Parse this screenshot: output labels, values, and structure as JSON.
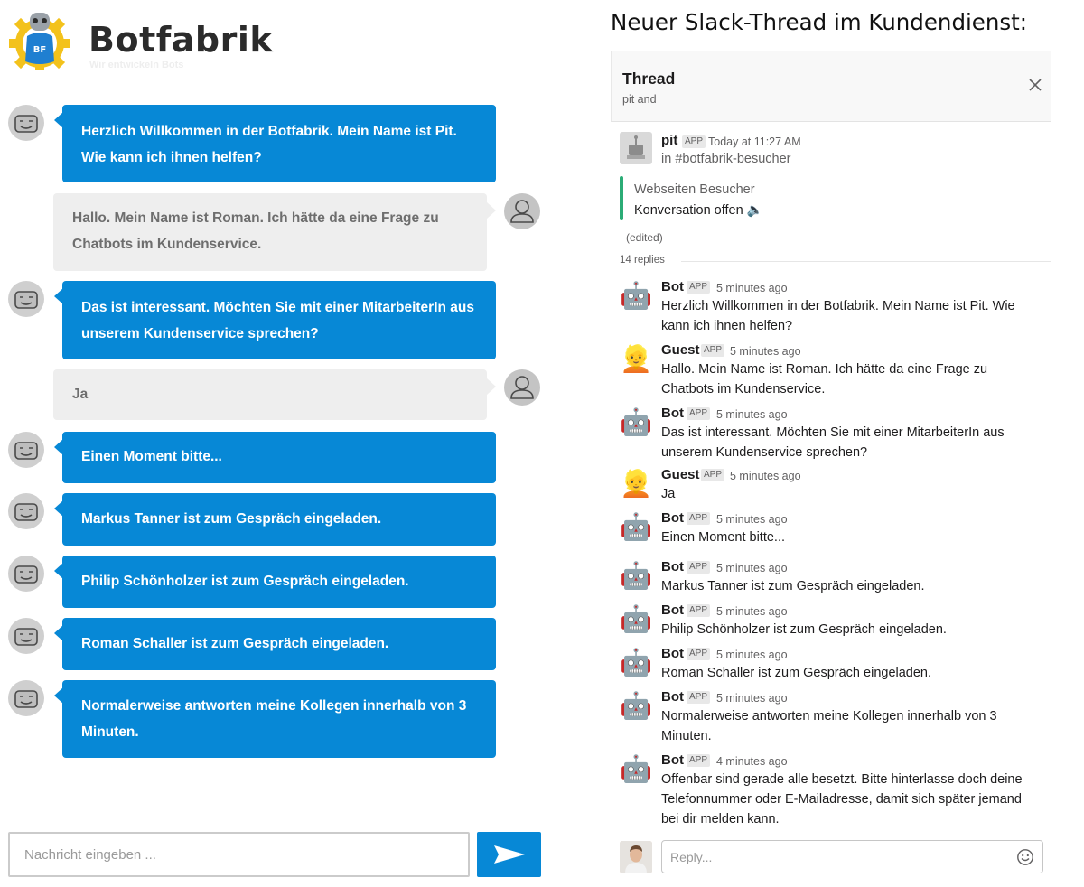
{
  "widget": {
    "brand": "Botfabrik",
    "tagline": "Wir entwickeln Bots",
    "logo_text": "BF",
    "messages": [
      {
        "from": "bot",
        "text": "Herzlich Willkommen in der Botfabrik. Mein Name ist Pit. Wie kann ich ihnen helfen?"
      },
      {
        "from": "user",
        "text": "Hallo. Mein Name ist Roman. Ich hätte da eine Frage zu Chatbots im Kundenservice."
      },
      {
        "from": "bot",
        "text": "Das ist interessant. Möchten Sie mit einer MitarbeiterIn aus unserem Kundenservice sprechen?"
      },
      {
        "from": "user",
        "text": "Ja"
      },
      {
        "from": "bot",
        "text": "Einen Moment bitte..."
      },
      {
        "from": "bot",
        "text": "Markus Tanner ist zum Gespräch eingeladen."
      },
      {
        "from": "bot",
        "text": "Philip Schönholzer ist zum Gespräch eingeladen."
      },
      {
        "from": "bot",
        "text": "Roman Schaller ist zum Gespräch eingeladen."
      },
      {
        "from": "bot",
        "text": "Normalerweise antworten meine Kollegen innerhalb von 3 Minuten."
      }
    ],
    "input_placeholder": "Nachricht eingeben ...",
    "send_icon": "send-arrow-icon",
    "accent_color": "#0788d6"
  },
  "slack": {
    "heading": "Neuer Slack-Thread im Kundendienst:",
    "panel_title": "Thread",
    "panel_subtitle": "pit and",
    "close_icon": "close-icon",
    "parent": {
      "sender": "pit",
      "badge": "APP",
      "time": "Today at 11:27 AM",
      "channel": "in #botfabrik-besucher",
      "attachment_title": "Webseiten Besucher",
      "attachment_text": "Konversation offen 🔈",
      "edited": "(edited)"
    },
    "replies_count": "14 replies",
    "replies": [
      {
        "sender": "Bot",
        "badge": "APP",
        "time": "5 minutes ago",
        "avatar": "robot-icon",
        "avatar_glyph": "🤖",
        "text": "Herzlich Willkommen in der Botfabrik. Mein Name ist Pit. Wie kann ich ihnen helfen?"
      },
      {
        "sender": "Guest",
        "badge": "APP",
        "time": "5 minutes ago",
        "avatar": "person-icon",
        "avatar_glyph": "👱",
        "text": "Hallo. Mein Name ist Roman. Ich hätte da eine Frage zu Chatbots im Kundenservice."
      },
      {
        "sender": "Bot",
        "badge": "APP",
        "time": "5 minutes ago",
        "avatar": "robot-icon",
        "avatar_glyph": "🤖",
        "text": "Das ist interessant. Möchten Sie mit einer MitarbeiterIn aus unserem Kundenservice sprechen?"
      },
      {
        "sender": "Guest",
        "badge": "APP",
        "time": "5 minutes ago",
        "avatar": "person-icon",
        "avatar_glyph": "👱",
        "text": "Ja"
      },
      {
        "sender": "Bot",
        "badge": "APP",
        "time": "5 minutes ago",
        "avatar": "robot-icon",
        "avatar_glyph": "🤖",
        "text": "Einen Moment bitte..."
      },
      {
        "sender": "Bot",
        "badge": "APP",
        "time": "5 minutes ago",
        "avatar": "robot-icon",
        "avatar_glyph": "🤖",
        "text": "Markus Tanner ist zum Gespräch eingeladen."
      },
      {
        "sender": "Bot",
        "badge": "APP",
        "time": "5 minutes ago",
        "avatar": "robot-icon",
        "avatar_glyph": "🤖",
        "text": "Philip Schönholzer ist zum Gespräch eingeladen."
      },
      {
        "sender": "Bot",
        "badge": "APP",
        "time": "5 minutes ago",
        "avatar": "robot-icon",
        "avatar_glyph": "🤖",
        "text": "Roman Schaller ist zum Gespräch eingeladen."
      },
      {
        "sender": "Bot",
        "badge": "APP",
        "time": "5 minutes ago",
        "avatar": "robot-icon",
        "avatar_glyph": "🤖",
        "text": "Normalerweise antworten meine Kollegen innerhalb von 3 Minuten."
      },
      {
        "sender": "Bot",
        "badge": "APP",
        "time": "4 minutes ago",
        "avatar": "robot-icon",
        "avatar_glyph": "🤖",
        "text": "Offenbar sind gerade alle besetzt. Bitte hinterlasse doch deine Telefonnummer oder E-Mailadresse, damit sich später jemand bei dir melden kann."
      }
    ],
    "reply_placeholder": "Reply...",
    "emoji_icon": "smiley-icon"
  }
}
